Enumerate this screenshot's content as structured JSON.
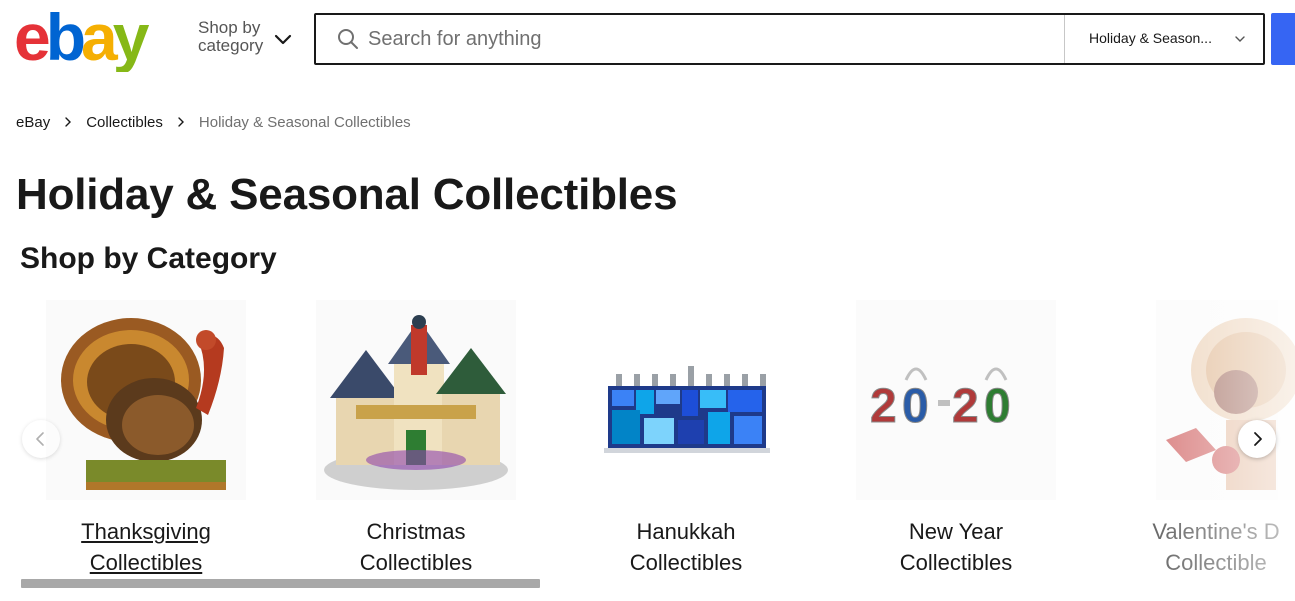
{
  "header": {
    "logo_text": "ebay",
    "shop_by_label_line1": "Shop by",
    "shop_by_label_line2": "category",
    "search_placeholder": "Search for anything",
    "category_select_value": "Holiday & Season...",
    "colors": {
      "e": "#e53238",
      "b": "#0064d2",
      "a": "#f5af02",
      "y": "#86b817",
      "search_button": "#3665f3"
    }
  },
  "breadcrumb": {
    "items": [
      "eBay",
      "Collectibles"
    ],
    "current": "Holiday & Seasonal Collectibles"
  },
  "page_title": "Holiday & Seasonal Collectibles",
  "section_title": "Shop by Category",
  "categories": [
    {
      "line1": "Thanksgiving",
      "line2": "Collectibles",
      "icon": "turkey-image"
    },
    {
      "line1": "Christmas",
      "line2": "Collectibles",
      "icon": "christmas-village-image"
    },
    {
      "line1": "Hanukkah",
      "line2": "Collectibles",
      "icon": "menorah-image"
    },
    {
      "line1": "New Year",
      "line2": "Collectibles",
      "icon": "2020-glasses-image"
    },
    {
      "line1": "Valentine's D",
      "line2": "Collectible",
      "icon": "valentine-decoration-image"
    }
  ],
  "carousel": {
    "prev_icon": "chevron-left-icon",
    "next_icon": "chevron-right-icon"
  }
}
